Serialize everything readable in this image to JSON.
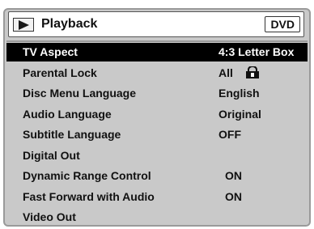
{
  "header": {
    "title": "Playback",
    "badge": "DVD",
    "icon": "play-icon"
  },
  "menu": {
    "items": [
      {
        "label": "TV Aspect",
        "value": "4:3 Letter Box",
        "selected": true
      },
      {
        "label": "Parental Lock",
        "value": "All",
        "icon": "lock-icon"
      },
      {
        "label": "Disc Menu Language",
        "value": "English"
      },
      {
        "label": "Audio Language",
        "value": "Original"
      },
      {
        "label": "Subtitle Language",
        "value": "OFF"
      },
      {
        "label": "Digital Out",
        "value": ""
      },
      {
        "label": "Dynamic Range Control",
        "value": "ON"
      },
      {
        "label": "Fast Forward with Audio",
        "value": "ON"
      },
      {
        "label": "Video Out",
        "value": ""
      }
    ]
  },
  "colors": {
    "panel": "#c9c9c9",
    "highlight": "#000000",
    "highlight_text": "#ffffff",
    "text": "#111111"
  }
}
